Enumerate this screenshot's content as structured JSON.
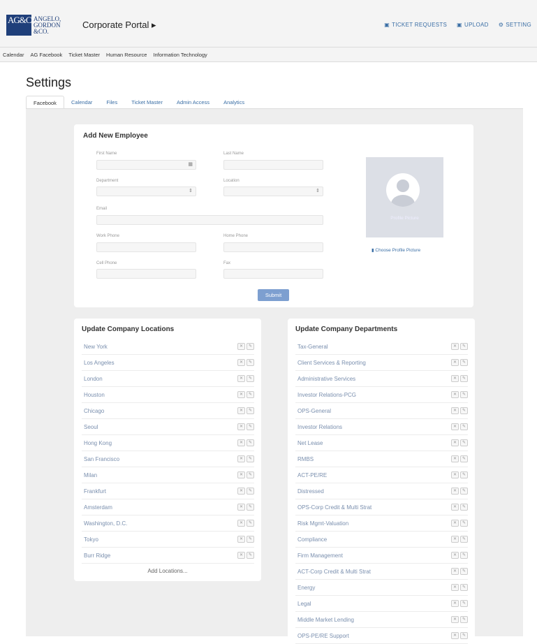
{
  "header": {
    "logo_mark": "AG&CO",
    "logo_lines": [
      "ANGELO,",
      "GORDON",
      "&CO."
    ],
    "portal_title": "Corporate Portal ▸",
    "actions": [
      {
        "icon": "ticket-icon",
        "label": "TICKET REQUESTS"
      },
      {
        "icon": "upload-icon",
        "label": "UPLOAD"
      },
      {
        "icon": "gear-icon",
        "label": "SETTING"
      }
    ]
  },
  "nav": [
    "Calendar",
    "AG Facebook",
    "Ticket Master",
    "Human Resource",
    "Information Technology"
  ],
  "page_title": "Settings",
  "tabs": [
    "Facebook",
    "Calendar",
    "Files",
    "Ticket Master",
    "Admin Access",
    "Analytics"
  ],
  "form": {
    "title": "Add New Employee",
    "first_name": "First Name",
    "last_name": "Last Name",
    "department": "Department",
    "location": "Location",
    "email": "Email",
    "work_phone": "Work Phone",
    "home_phone": "Home Phone",
    "cell_phone": "Cell Phone",
    "fax": "Fax",
    "picture_caption": "Profile Picture",
    "choose_picture": "Choose Profile Picture",
    "submit": "Submit"
  },
  "locations": {
    "title": "Update Company Locations",
    "items": [
      "New York",
      "Los Angeles",
      "London",
      "Houston",
      "Chicago",
      "Seoul",
      "Hong Kong",
      "San Francisco",
      "Milan",
      "Frankfurt",
      "Amsterdam",
      "Washington, D.C.",
      "Tokyo",
      "Burr Ridge"
    ],
    "add_label": "Add Locations..."
  },
  "departments": {
    "title": "Update Company Departments",
    "items": [
      "Tax-General",
      "Client Services & Reporting",
      "Administrative Services",
      "Investor Relations-PCG",
      "OPS-General",
      "Investor Relations",
      "Net Lease",
      "RMBS",
      "ACT-PE/RE",
      "Distressed",
      "OPS-Corp Credit & Multi Strat",
      "Risk Mgmt-Valuation",
      "Compliance",
      "Firm Management",
      "ACT-Corp Credit & Multi Strat",
      "Energy",
      "Legal",
      "Middle Market Lending",
      "OPS-PE/RE Support"
    ]
  },
  "colors": {
    "brand": "#1f3f7a",
    "link": "#3a6ea5",
    "submit": "#7d9fd0"
  }
}
